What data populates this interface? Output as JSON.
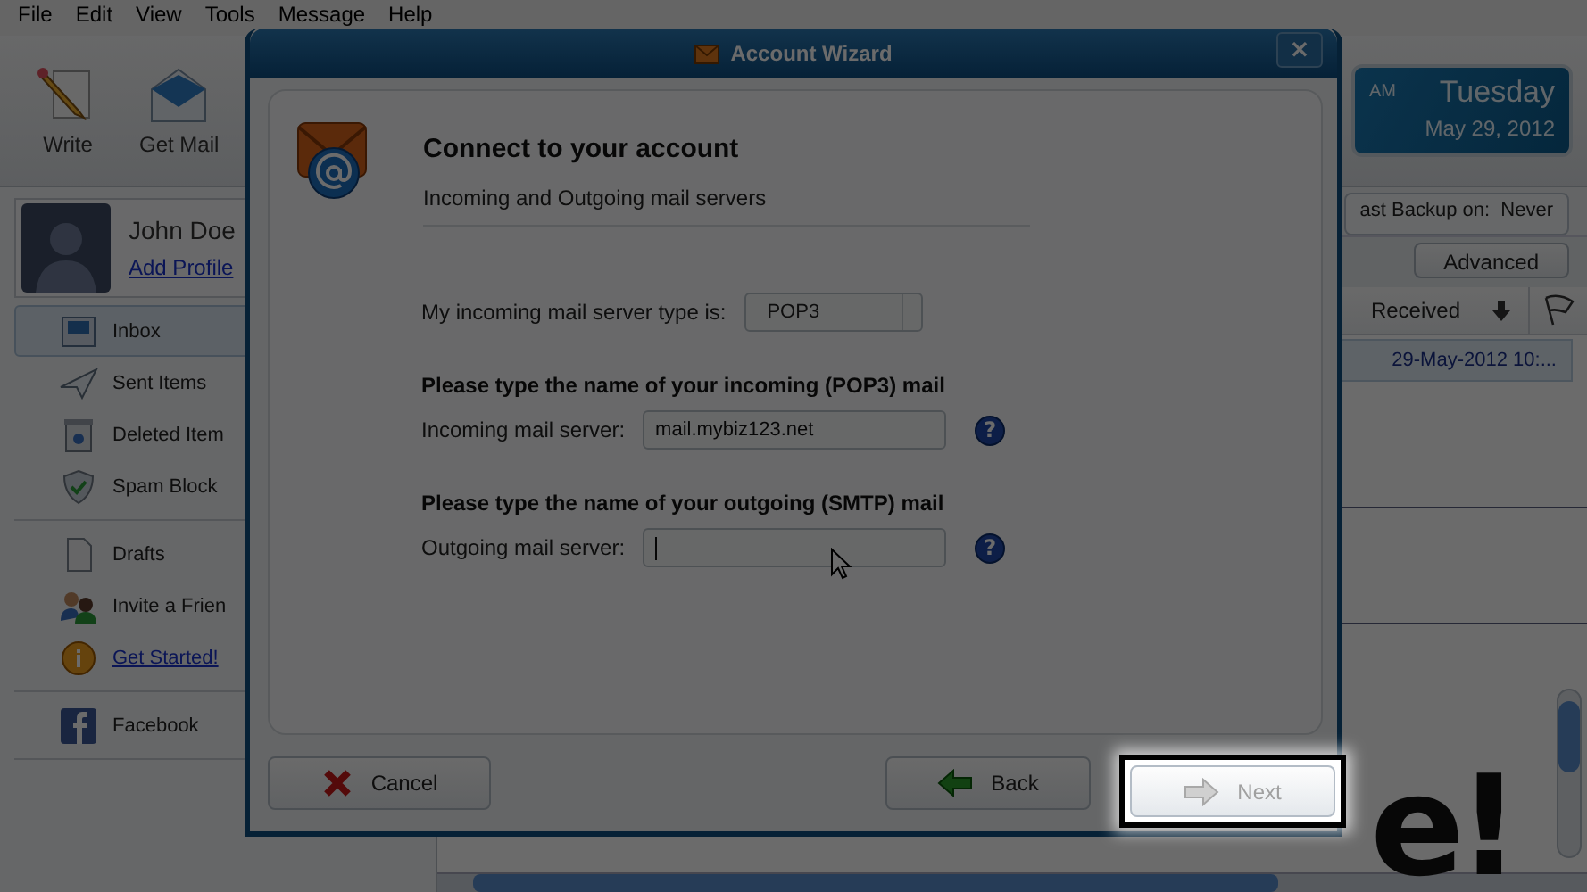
{
  "menu": [
    "File",
    "Edit",
    "View",
    "Tools",
    "Message",
    "Help"
  ],
  "toolbar": [
    {
      "label": "Write",
      "kind": "write"
    },
    {
      "label": "Get Mail",
      "kind": "getmail"
    }
  ],
  "clock": {
    "ampm": "AM",
    "day": "Tuesday",
    "date": "May 29, 2012"
  },
  "profile": {
    "name": "John Doe",
    "link": "Add Profile"
  },
  "sidebar": {
    "groups": [
      [
        {
          "label": "Inbox",
          "kind": "inbox",
          "selected": true,
          "link": false
        },
        {
          "label": "Sent Items",
          "kind": "sent",
          "selected": false,
          "link": false
        },
        {
          "label": "Deleted Item",
          "kind": "deleted",
          "selected": false,
          "link": false
        },
        {
          "label": "Spam Block",
          "kind": "spam",
          "selected": false,
          "link": false
        }
      ],
      [
        {
          "label": "Drafts",
          "kind": "drafts",
          "selected": false,
          "link": false
        },
        {
          "label": "Invite a Frien",
          "kind": "invite",
          "selected": false,
          "link": false
        },
        {
          "label": "Get Started!",
          "kind": "info",
          "selected": false,
          "link": true
        }
      ],
      [
        {
          "label": "Facebook",
          "kind": "facebook",
          "selected": false,
          "link": false
        }
      ]
    ]
  },
  "backup": {
    "label": "ast Backup on:",
    "value": "Never"
  },
  "advanced_button": "Advanced",
  "table": {
    "columns": [
      {
        "label": "Received",
        "sorted": true
      }
    ],
    "rows": [
      {
        "received": "29-May-2012 10:...",
        "selected": true
      }
    ]
  },
  "banner": "e!",
  "dialog": {
    "title": "Account Wizard",
    "close": "×",
    "heading": "Connect to your account",
    "subheading": "Incoming and Outgoing mail servers",
    "server_type": {
      "label": "My incoming mail server type is:",
      "value": "POP3"
    },
    "incoming": {
      "heading": "Please type the name of your incoming (POP3) mail",
      "label": "Incoming mail server:",
      "value": "mail.mybiz123.net",
      "help": "?"
    },
    "outgoing": {
      "heading": "Please type the name of your outgoing (SMTP) mail",
      "label": "Outgoing mail server:",
      "help": "?"
    },
    "buttons": [
      {
        "label": "Cancel",
        "kind": "cancel",
        "disabled": false
      },
      {
        "label": "Back",
        "kind": "back",
        "disabled": false
      },
      {
        "label": "Next",
        "kind": "next",
        "disabled": true
      }
    ]
  }
}
